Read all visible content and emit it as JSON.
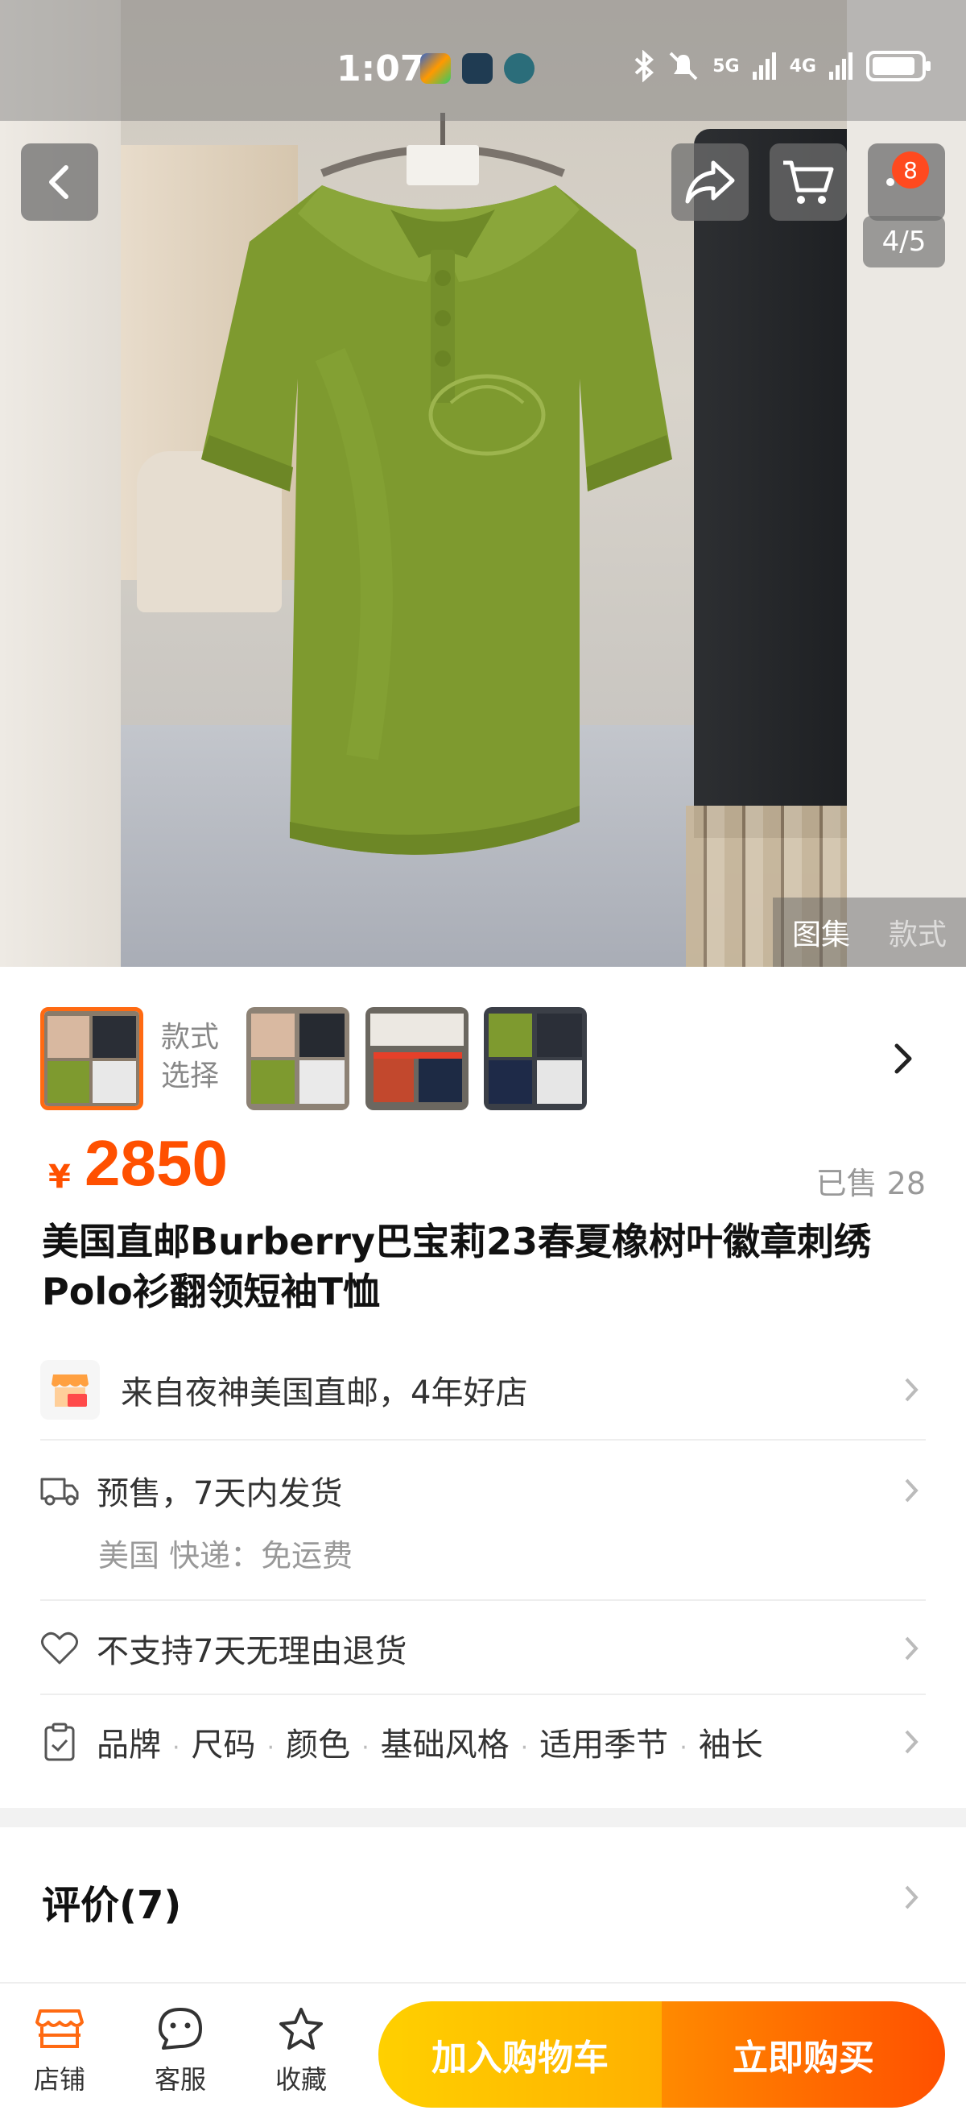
{
  "status_bar": {
    "time": "1:07",
    "network_5g": "5G",
    "network_4g": "4G"
  },
  "top_nav": {
    "cart_badge": "8",
    "pager": "4/5"
  },
  "gallery_switch": {
    "active": "图集",
    "inactive": "款式"
  },
  "style_picker": {
    "label_line1": "款式",
    "label_line2": "选择"
  },
  "product": {
    "currency": "¥",
    "price": "2850",
    "sold": "已售 28",
    "title": "美国直邮Burberry巴宝莉23春夏橡树叶徽章刺绣Polo衫翻领短袖T恤"
  },
  "shop_row": {
    "text": "来自夜神美国直邮，4年好店"
  },
  "shipping_row": {
    "text": "预售，7天内发货",
    "sub": "美国  快递：免运费"
  },
  "return_row": {
    "text": "不支持7天无理由退货"
  },
  "attributes_row": {
    "items": [
      "品牌",
      "尺码",
      "颜色",
      "基础风格",
      "适用季节",
      "袖长"
    ]
  },
  "reviews": {
    "title": "评价(7)"
  },
  "bottom_bar": {
    "shop_label": "店铺",
    "service_label": "客服",
    "favorite_label": "收藏",
    "add_to_cart": "加入购物车",
    "buy_now": "立即购买"
  },
  "colors": {
    "accent_orange": "#ff5000",
    "cart_yellow": "#ffc000",
    "shirt_green": "#7e9a2f"
  }
}
